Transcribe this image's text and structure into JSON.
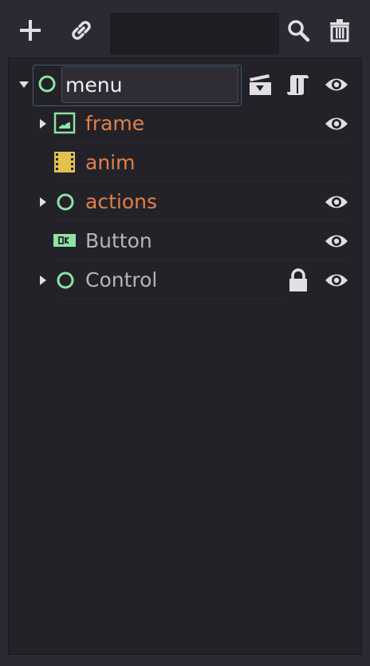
{
  "toolbar": {
    "search": {
      "value": "",
      "placeholder": ""
    },
    "buttons": [
      "add-icon",
      "link-icon",
      "search-icon",
      "trash-icon"
    ]
  },
  "tree": {
    "root": {
      "name": "menu",
      "icon": "node-circle-icon",
      "expanded": true
    },
    "items": [
      {
        "label": "frame",
        "icon": "sprite-icon"
      },
      {
        "label": "anim",
        "icon": "animation-player-icon"
      },
      {
        "label": "actions",
        "icon": "node-circle-icon"
      },
      {
        "label": "Button",
        "icon": "button-icon"
      },
      {
        "label": "Control",
        "icon": "node-circle-icon"
      }
    ]
  },
  "colors": {
    "background": "#2b2a33",
    "tree_background": "#232228",
    "node_green": "#8ee2a8",
    "label_orange": "#e0804a",
    "label_gray": "#b4b4ba",
    "anim_yellow": "#e2c24e",
    "icon_light": "#e0e0e4"
  }
}
